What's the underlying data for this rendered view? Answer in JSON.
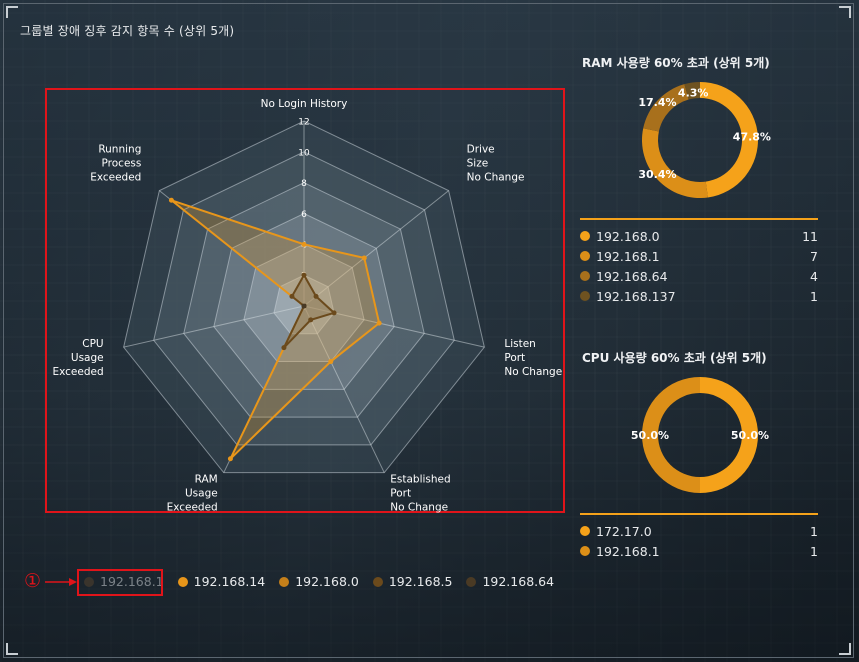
{
  "main_title": "그룹별 장애 징후 감지 항목 수 (상위 5개)",
  "callout_number": "①",
  "chart_data": [
    {
      "type": "radar",
      "axes": [
        "No Login History",
        "Drive Size No Change",
        "Listen Port No Change",
        "Established Port No Change",
        "RAM Usage Exceeded",
        "CPU Usage Exceeded",
        "Running Process Exceeded"
      ],
      "axis_label_lines": [
        [
          "No Login History"
        ],
        [
          "Drive",
          "Size",
          "No Change"
        ],
        [
          "Listen",
          "Port",
          "No Change"
        ],
        [
          "Established",
          "Port",
          "No Change"
        ],
        [
          "RAM",
          "Usage",
          "Exceeded"
        ],
        [
          "CPU",
          "Usage",
          "Exceeded"
        ],
        [
          "Running",
          "Process",
          "Exceeded"
        ]
      ],
      "rlim": [
        0,
        12
      ],
      "ticks": [
        "0",
        "2",
        "4",
        "6",
        "8",
        "10",
        "12"
      ],
      "series": [
        {
          "name": "192.168.1",
          "values": [
            0,
            0,
            0,
            0,
            0,
            0,
            0
          ],
          "color": "#7a7268",
          "visible": false
        },
        {
          "name": "192.168.14",
          "values": [
            4,
            5,
            5,
            4,
            11,
            0,
            11
          ],
          "color": "#e8961a",
          "visible": true
        },
        {
          "name": "192.168.0",
          "values": [
            0,
            0,
            0,
            0,
            0,
            0,
            0
          ],
          "color": "#c5801a",
          "visible": true
        },
        {
          "name": "192.168.5",
          "values": [
            2,
            1,
            2,
            1,
            3,
            0,
            1
          ],
          "color": "#6b4a1c",
          "visible": true
        },
        {
          "name": "192.168.64",
          "values": [
            0,
            0,
            0,
            0,
            0,
            0,
            0
          ],
          "color": "#4a3a24",
          "visible": true
        }
      ]
    },
    {
      "type": "pie",
      "title": "RAM 사용량 60% 초과 (상위 5개)",
      "categories": [
        "192.168.0",
        "192.168.1",
        "192.168.64",
        "192.168.137"
      ],
      "values": [
        11,
        7,
        4,
        1
      ],
      "labels": [
        "47.8%",
        "30.4%",
        "17.4%",
        "4.3%"
      ],
      "colors": [
        "#f5a21a",
        "#dc8f18",
        "#a8701c",
        "#6e5220"
      ]
    },
    {
      "type": "pie",
      "title": "CPU 사용량 60% 초과 (상위 5개)",
      "categories": [
        "172.17.0",
        "192.168.1"
      ],
      "values": [
        1,
        1
      ],
      "labels": [
        "50.0%",
        "50.0%"
      ],
      "colors": [
        "#f5a21a",
        "#dc8f18"
      ]
    }
  ]
}
